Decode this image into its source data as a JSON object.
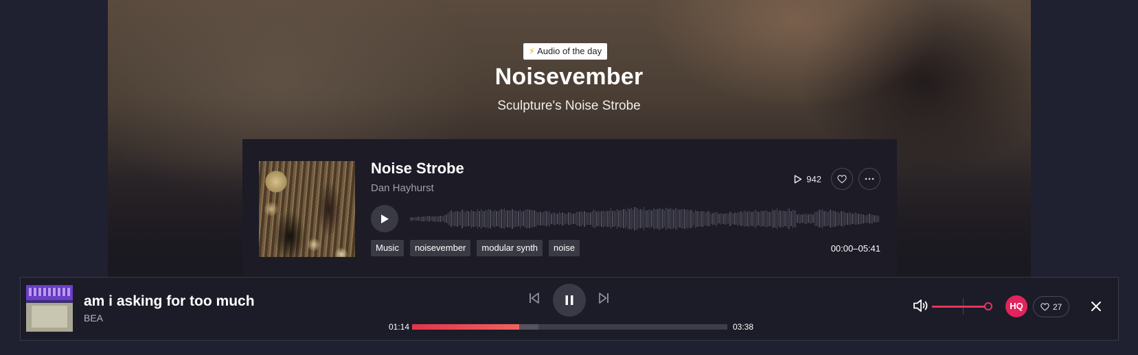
{
  "hero": {
    "badge_icon": "lightning-bolt-icon",
    "badge_bolt": "⚡",
    "badge_label": "Audio of the day",
    "title": "Noisevember",
    "subtitle": "Sculpture's Noise Strobe"
  },
  "card": {
    "title": "Noise Strobe",
    "artist": "Dan Hayhurst",
    "plays": "942",
    "tags": [
      "Music",
      "noisevember",
      "modular synth",
      "noise"
    ],
    "duration": "00:00–05:41"
  },
  "player": {
    "title": "am i asking for too much",
    "artist": "BEA",
    "current_time": "01:14",
    "total_time": "03:38",
    "progress": 0.34,
    "volume": 1.0,
    "quality_label": "HQ",
    "likes": "27"
  },
  "colors": {
    "accent": "#e1255c",
    "progress_start": "#e3334c",
    "progress_end": "#f0625e"
  }
}
